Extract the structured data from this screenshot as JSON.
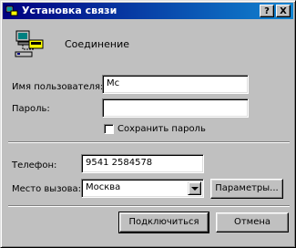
{
  "window": {
    "title": "Установка связи",
    "help_button": "?",
    "close_button": "X"
  },
  "connection": {
    "name": "Соединение"
  },
  "form": {
    "username_label": "Имя пользователя:",
    "username_value": "Mc",
    "password_label": "Пароль:",
    "password_value": "",
    "save_password_label": "Сохранить пароль",
    "save_password_checked": false,
    "phone_label": "Телефон:",
    "phone_value": "9541 2584578",
    "dial_from_label": "Место вызова:",
    "dial_from_value": "Москва",
    "params_button": "Параметры..."
  },
  "actions": {
    "connect_button": "Подключиться",
    "cancel_button": "Отмена"
  }
}
